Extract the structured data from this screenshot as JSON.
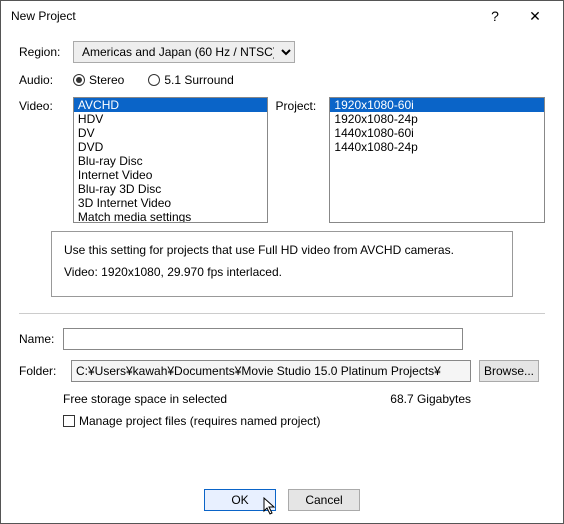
{
  "window": {
    "title": "New Project",
    "help": "?",
    "close": "✕"
  },
  "labels": {
    "region": "Region:",
    "audio": "Audio:",
    "video": "Video:",
    "project": "Project:",
    "name": "Name:",
    "folder": "Folder:"
  },
  "region": {
    "selected": "Americas and Japan (60 Hz / NTSC)"
  },
  "audio": {
    "stereo": "Stereo",
    "surround": "5.1 Surround"
  },
  "video_options": [
    "AVCHD",
    "HDV",
    "DV",
    "DVD",
    "Blu-ray Disc",
    "Internet Video",
    "Blu-ray 3D Disc",
    "3D Internet Video",
    "Match media settings"
  ],
  "project_options": [
    "1920x1080-60i",
    "1920x1080-24p",
    "1440x1080-60i",
    "1440x1080-24p"
  ],
  "description": {
    "line1": "Use this setting for projects that use Full HD video from AVCHD cameras.",
    "line2": "Video: 1920x1080, 29.970 fps interlaced."
  },
  "name_value": "",
  "folder_value": "C:¥Users¥kawah¥Documents¥Movie Studio 15.0 Platinum Projects¥",
  "browse": "Browse...",
  "storage": {
    "label": "Free storage space in selected",
    "value": "68.7 Gigabytes"
  },
  "manage": {
    "label": "Manage project files (requires named project)"
  },
  "buttons": {
    "ok": "OK",
    "cancel": "Cancel"
  }
}
